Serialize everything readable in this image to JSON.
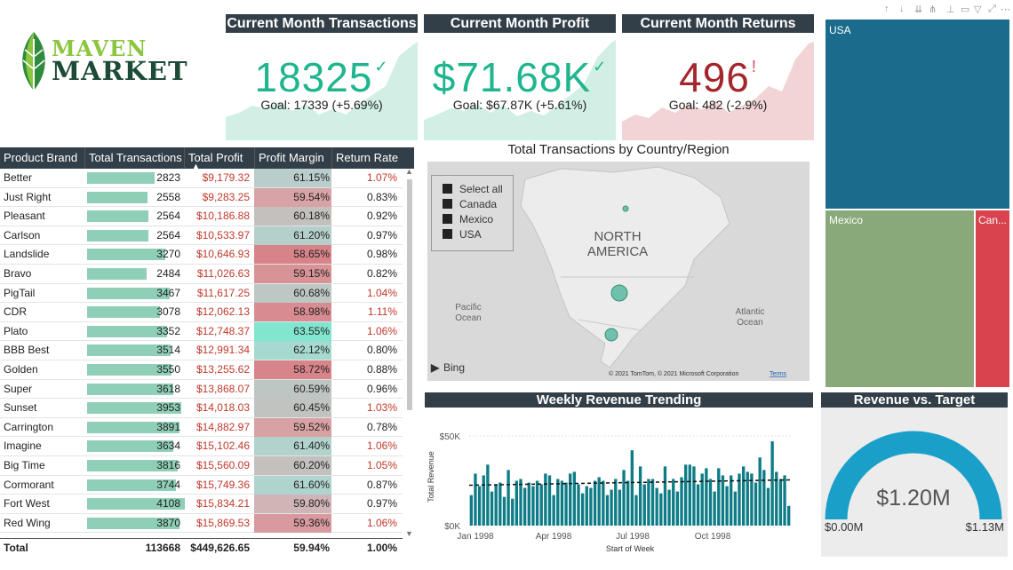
{
  "brand": {
    "line1": "MAVEN",
    "line2": "MARKET"
  },
  "kpis": [
    {
      "title": "Current Month Transactions",
      "value": "18325",
      "mark": "✓",
      "goal": "Goal: 17339 (+5.69%)",
      "color": "#1fb58f",
      "spark": "#d1efe4"
    },
    {
      "title": "Current Month Profit",
      "value": "$71.68K",
      "mark": "✓",
      "goal": "Goal: $67.87K (+5.61%)",
      "color": "#1fb58f",
      "spark": "#d1efe4"
    },
    {
      "title": "Current Month Returns",
      "value": "496",
      "mark": "!",
      "goal": "Goal: 482 (-2.9%)",
      "color": "#a4262c",
      "spark": "#f2d4d6"
    }
  ],
  "table": {
    "headers": [
      "Product Brand",
      "Total Transactions",
      "Total Profit",
      "Profit Margin",
      "Return Rate"
    ],
    "rows": [
      {
        "brand": "Better",
        "tx": 2823,
        "tx_label": "2823",
        "profit": "$9,179.32",
        "margin": "61.15%",
        "margin_color": "#b9cdca",
        "rr": "1.07%",
        "rr_color": "#c0392b"
      },
      {
        "brand": "Just Right",
        "tx": 2558,
        "tx_label": "2558",
        "profit": "$9,283.25",
        "margin": "59.54%",
        "margin_color": "#d8a3a6",
        "rr": "0.83%",
        "rr_color": "#222222"
      },
      {
        "brand": "Pleasant",
        "tx": 2564,
        "tx_label": "2564",
        "profit": "$10,186.88",
        "margin": "60.18%",
        "margin_color": "#c3c0be",
        "rr": "0.92%",
        "rr_color": "#222222"
      },
      {
        "brand": "Carlson",
        "tx": 2564,
        "tx_label": "2564",
        "profit": "$10,533.97",
        "margin": "61.20%",
        "margin_color": "#b5d0cb",
        "rr": "0.97%",
        "rr_color": "#222222"
      },
      {
        "brand": "Landslide",
        "tx": 3270,
        "tx_label": "3270",
        "profit": "$10,646.93",
        "margin": "58.65%",
        "margin_color": "#d8838a",
        "rr": "0.98%",
        "rr_color": "#222222"
      },
      {
        "brand": "Bravo",
        "tx": 2484,
        "tx_label": "2484",
        "profit": "$11,026.63",
        "margin": "59.15%",
        "margin_color": "#d89397",
        "rr": "0.82%",
        "rr_color": "#222222"
      },
      {
        "brand": "PigTail",
        "tx": 3467,
        "tx_label": "3467",
        "profit": "$11,617.25",
        "margin": "60.68%",
        "margin_color": "#bdc8c5",
        "rr": "1.04%",
        "rr_color": "#c0392b"
      },
      {
        "brand": "CDR",
        "tx": 3078,
        "tx_label": "3078",
        "profit": "$12,062.13",
        "margin": "58.98%",
        "margin_color": "#d88c91",
        "rr": "1.11%",
        "rr_color": "#c0392b"
      },
      {
        "brand": "Plato",
        "tx": 3352,
        "tx_label": "3352",
        "profit": "$12,748.37",
        "margin": "63.55%",
        "margin_color": "#82e6cf",
        "rr": "1.06%",
        "rr_color": "#c0392b"
      },
      {
        "brand": "BBB Best",
        "tx": 3514,
        "tx_label": "3514",
        "profit": "$12,991.34",
        "margin": "62.12%",
        "margin_color": "#a6d9d0",
        "rr": "0.80%",
        "rr_color": "#222222"
      },
      {
        "brand": "Golden",
        "tx": 3550,
        "tx_label": "3550",
        "profit": "$13,255.62",
        "margin": "58.72%",
        "margin_color": "#d8848b",
        "rr": "0.88%",
        "rr_color": "#222222"
      },
      {
        "brand": "Super",
        "tx": 3618,
        "tx_label": "3618",
        "profit": "$13,868.07",
        "margin": "60.59%",
        "margin_color": "#bec6c4",
        "rr": "0.96%",
        "rr_color": "#222222"
      },
      {
        "brand": "Sunset",
        "tx": 3953,
        "tx_label": "3953",
        "profit": "$14,018.03",
        "margin": "60.45%",
        "margin_color": "#c1c3c1",
        "rr": "1.03%",
        "rr_color": "#c0392b"
      },
      {
        "brand": "Carrington",
        "tx": 3891,
        "tx_label": "3891",
        "profit": "$14,882.97",
        "margin": "59.52%",
        "margin_color": "#d8a2a5",
        "rr": "0.78%",
        "rr_color": "#222222"
      },
      {
        "brand": "Imagine",
        "tx": 3634,
        "tx_label": "3634",
        "profit": "$15,102.46",
        "margin": "61.40%",
        "margin_color": "#b2d2cc",
        "rr": "1.06%",
        "rr_color": "#c0392b"
      },
      {
        "brand": "Big Time",
        "tx": 3816,
        "tx_label": "3816",
        "profit": "$15,560.09",
        "margin": "60.20%",
        "margin_color": "#c3c0be",
        "rr": "1.05%",
        "rr_color": "#c0392b"
      },
      {
        "brand": "Cormorant",
        "tx": 3744,
        "tx_label": "3744",
        "profit": "$15,749.36",
        "margin": "61.60%",
        "margin_color": "#afd3cd",
        "rr": "0.87%",
        "rr_color": "#222222"
      },
      {
        "brand": "Fort West",
        "tx": 4108,
        "tx_label": "4108",
        "profit": "$15,834.21",
        "margin": "59.80%",
        "margin_color": "#cfb5b6",
        "rr": "0.97%",
        "rr_color": "#222222"
      },
      {
        "brand": "Red Wing",
        "tx": 3870,
        "tx_label": "3870",
        "profit": "$15,869.53",
        "margin": "59.36%",
        "margin_color": "#d89a9e",
        "rr": "1.06%",
        "rr_color": "#c0392b"
      }
    ],
    "total": {
      "label": "Total",
      "tx": "113668",
      "profit": "$449,626.65",
      "margin": "59.94%",
      "rr": "1.00%"
    }
  },
  "map": {
    "title": "Total Transactions by Country/Region",
    "legend": [
      "Select all",
      "Canada",
      "Mexico",
      "USA"
    ],
    "continent_line1": "NORTH",
    "continent_line2": "AMERICA",
    "pacific1": "Pacific",
    "pacific2": "Ocean",
    "atlantic1": "Atlantic",
    "atlantic2": "Ocean",
    "bing": "Bing",
    "copyright": "© 2021 TomTom, © 2021 Microsoft Corporation",
    "terms": "Terms"
  },
  "treemap": [
    {
      "name": "USA",
      "color": "#1a6b8c"
    },
    {
      "name": "Mexico",
      "color": "#8aa97a"
    },
    {
      "name": "Can...",
      "color": "#d8434d"
    }
  ],
  "weekly": {
    "title": "Weekly Revenue Trending",
    "ylabel": "Total Revenue",
    "xlabel": "Start of Week",
    "y_ticks": [
      "$50K",
      "$0K"
    ],
    "x_ticks": [
      "Jan 1998",
      "Apr 1998",
      "Jul 1998",
      "Oct 1998"
    ]
  },
  "gauge": {
    "title": "Revenue vs. Target",
    "value_label": "$1.20M",
    "min_label": "$0.00M",
    "max_label": "$1.13M",
    "color": "#1aa0c8"
  },
  "chart_data": [
    {
      "type": "bar",
      "title": "Weekly Revenue Trending",
      "xlabel": "Start of Week",
      "ylabel": "Total Revenue",
      "ylim": [
        0,
        50000
      ],
      "x_ticks": [
        "Jan 1998",
        "Apr 1998",
        "Jul 1998",
        "Oct 1998"
      ],
      "values": [
        17000,
        29000,
        22000,
        28000,
        34000,
        19000,
        23000,
        24000,
        16000,
        31000,
        15000,
        25000,
        26000,
        21000,
        24000,
        22000,
        25000,
        23000,
        29000,
        28000,
        17000,
        26000,
        25000,
        24000,
        29000,
        30000,
        23000,
        18000,
        22000,
        21000,
        25000,
        27000,
        25000,
        17000,
        20000,
        26000,
        20000,
        31000,
        25000,
        42000,
        17000,
        33000,
        23000,
        26000,
        26000,
        21000,
        18000,
        33000,
        20000,
        26000,
        19000,
        27000,
        34000,
        34000,
        33000,
        23000,
        29000,
        32000,
        26000,
        19000,
        32000,
        28000,
        22000,
        28000,
        19000,
        29000,
        33000,
        30000,
        29000,
        24000,
        38000,
        31000,
        21000,
        47000,
        30000,
        26000,
        28000,
        11000
      ],
      "trend_start": 22500,
      "trend_end": 25500
    },
    {
      "type": "gauge",
      "title": "Revenue vs. Target",
      "value": 1.2,
      "target": 1.13,
      "min": 0,
      "unit": "$M"
    }
  ]
}
